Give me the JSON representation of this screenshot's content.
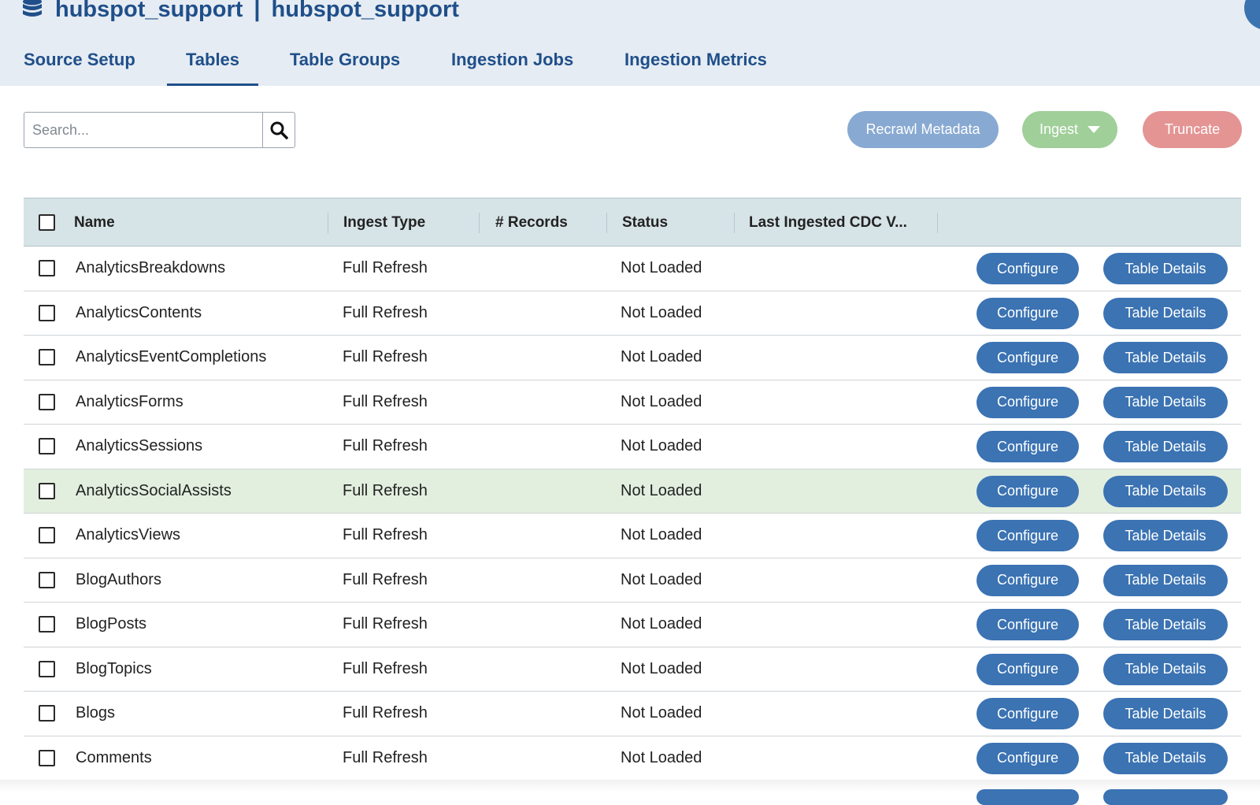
{
  "header": {
    "db_icon": "database-icon",
    "title_left": "hubspot_support",
    "separator": "|",
    "title_right": "hubspot_support"
  },
  "tabs": [
    {
      "label": "Source Setup",
      "active": false
    },
    {
      "label": "Tables",
      "active": true
    },
    {
      "label": "Table Groups",
      "active": false
    },
    {
      "label": "Ingestion Jobs",
      "active": false
    },
    {
      "label": "Ingestion Metrics",
      "active": false
    }
  ],
  "toolbar": {
    "search_placeholder": "Search...",
    "search_icon": "search-icon",
    "recrawl_label": "Recrawl Metadata",
    "ingest_label": "Ingest",
    "truncate_label": "Truncate"
  },
  "table": {
    "columns": {
      "name": "Name",
      "ingest_type": "Ingest Type",
      "records": "# Records",
      "status": "Status",
      "last_ingested": "Last Ingested CDC V..."
    },
    "configure_label": "Configure",
    "details_label": "Table Details",
    "rows": [
      {
        "name": "AnalyticsBreakdowns",
        "ingest_type": "Full Refresh",
        "records": "",
        "status": "Not Loaded",
        "last_ingested": ""
      },
      {
        "name": "AnalyticsContents",
        "ingest_type": "Full Refresh",
        "records": "",
        "status": "Not Loaded",
        "last_ingested": ""
      },
      {
        "name": "AnalyticsEventCompletions",
        "ingest_type": "Full Refresh",
        "records": "",
        "status": "Not Loaded",
        "last_ingested": ""
      },
      {
        "name": "AnalyticsForms",
        "ingest_type": "Full Refresh",
        "records": "",
        "status": "Not Loaded",
        "last_ingested": ""
      },
      {
        "name": "AnalyticsSessions",
        "ingest_type": "Full Refresh",
        "records": "",
        "status": "Not Loaded",
        "last_ingested": ""
      },
      {
        "name": "AnalyticsSocialAssists",
        "ingest_type": "Full Refresh",
        "records": "",
        "status": "Not Loaded",
        "last_ingested": "",
        "highlighted": true
      },
      {
        "name": "AnalyticsViews",
        "ingest_type": "Full Refresh",
        "records": "",
        "status": "Not Loaded",
        "last_ingested": ""
      },
      {
        "name": "BlogAuthors",
        "ingest_type": "Full Refresh",
        "records": "",
        "status": "Not Loaded",
        "last_ingested": ""
      },
      {
        "name": "BlogPosts",
        "ingest_type": "Full Refresh",
        "records": "",
        "status": "Not Loaded",
        "last_ingested": ""
      },
      {
        "name": "BlogTopics",
        "ingest_type": "Full Refresh",
        "records": "",
        "status": "Not Loaded",
        "last_ingested": ""
      },
      {
        "name": "Blogs",
        "ingest_type": "Full Refresh",
        "records": "",
        "status": "Not Loaded",
        "last_ingested": ""
      },
      {
        "name": "Comments",
        "ingest_type": "Full Refresh",
        "records": "",
        "status": "Not Loaded",
        "last_ingested": ""
      }
    ]
  },
  "colors": {
    "primary": "#3b73b3",
    "title": "#1f4f8a",
    "header_bg": "#e6ecf3",
    "table_header_bg": "#d6e3e7",
    "row_highlight": "#e2efdf",
    "recrawl": "#88a9d1",
    "ingest": "#a0cf99",
    "truncate": "#e49493"
  }
}
